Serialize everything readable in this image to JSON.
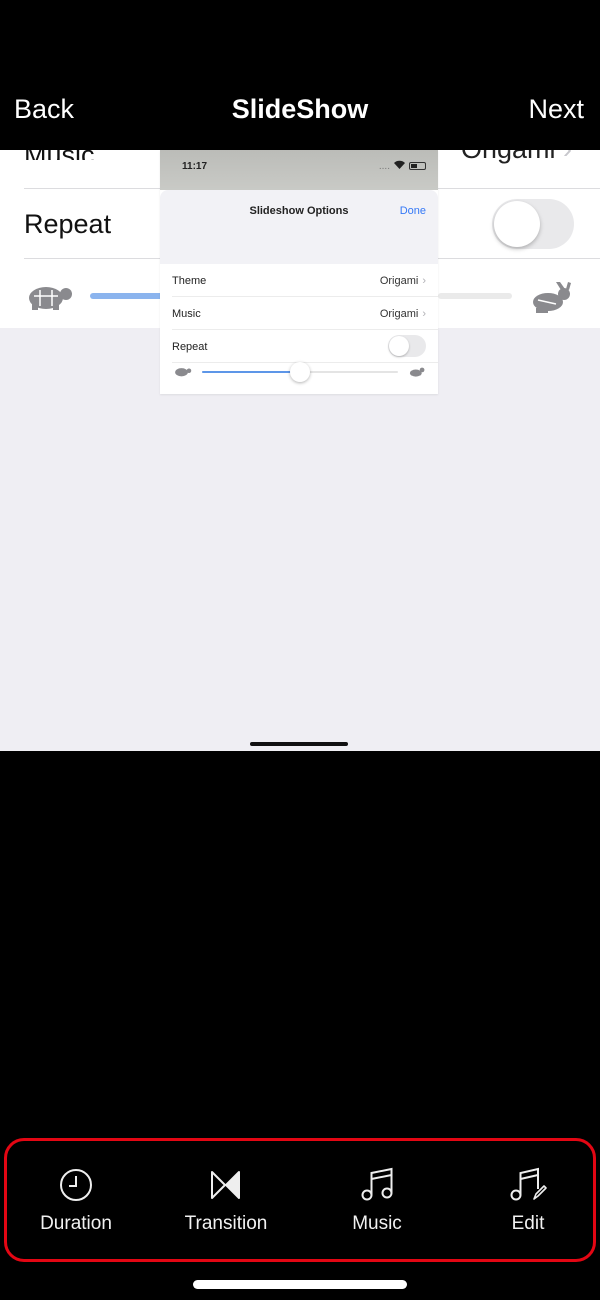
{
  "nav": {
    "back_label": "Back",
    "title": "SlideShow",
    "next_label": "Next"
  },
  "preview": {
    "background_list": {
      "music_label": "Music",
      "music_value": "Origami",
      "repeat_label": "Repeat",
      "repeat_on": false,
      "speed_icon_slow": "turtle-icon",
      "speed_icon_fast": "rabbit-icon"
    },
    "inner_screenshot": {
      "status_time": "11:17",
      "status_signal": "....",
      "sheet_title": "Slideshow Options",
      "done_label": "Done",
      "rows": [
        {
          "label": "Theme",
          "value": "Origami",
          "chevron": "›"
        },
        {
          "label": "Music",
          "value": "Origami",
          "chevron": "›"
        }
      ],
      "repeat_label": "Repeat",
      "repeat_on": false,
      "speed_fraction": 0.5
    }
  },
  "toolbar": {
    "highlight_color": "#e30613",
    "items": [
      {
        "label": "Duration",
        "icon": "clock-icon"
      },
      {
        "label": "Transition",
        "icon": "transition-icon"
      },
      {
        "label": "Music",
        "icon": "music-note-icon"
      },
      {
        "label": "Edit",
        "icon": "music-edit-icon"
      }
    ]
  }
}
